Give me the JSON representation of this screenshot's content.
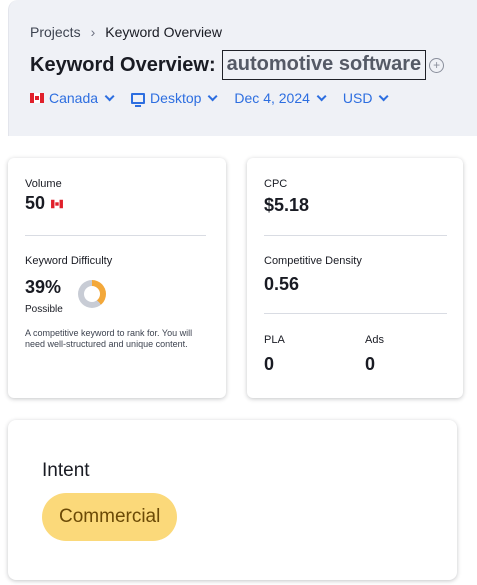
{
  "breadcrumb": {
    "projects": "Projects",
    "current": "Keyword Overview"
  },
  "title": {
    "prefix": "Keyword Overview:",
    "keyword": "automotive software"
  },
  "filters": {
    "country": "Canada",
    "device": "Desktop",
    "date": "Dec 4, 2024",
    "currency": "USD"
  },
  "metrics": {
    "volume_label": "Volume",
    "volume_value": "50",
    "kd_label": "Keyword Difficulty",
    "kd_value": "39%",
    "kd_percent": 39,
    "kd_level": "Possible",
    "kd_description": "A competitive keyword to rank for. You will need well-structured and unique content.",
    "cpc_label": "CPC",
    "cpc_value": "$5.18",
    "density_label": "Competitive Density",
    "density_value": "0.56",
    "pla_label": "PLA",
    "pla_value": "0",
    "ads_label": "Ads",
    "ads_value": "0"
  },
  "intent": {
    "title": "Intent",
    "badge": "Commercial"
  },
  "colors": {
    "accent": "#2d6ee0",
    "difficulty": "#f3a83a",
    "intent_badge": "#fbd97a"
  }
}
